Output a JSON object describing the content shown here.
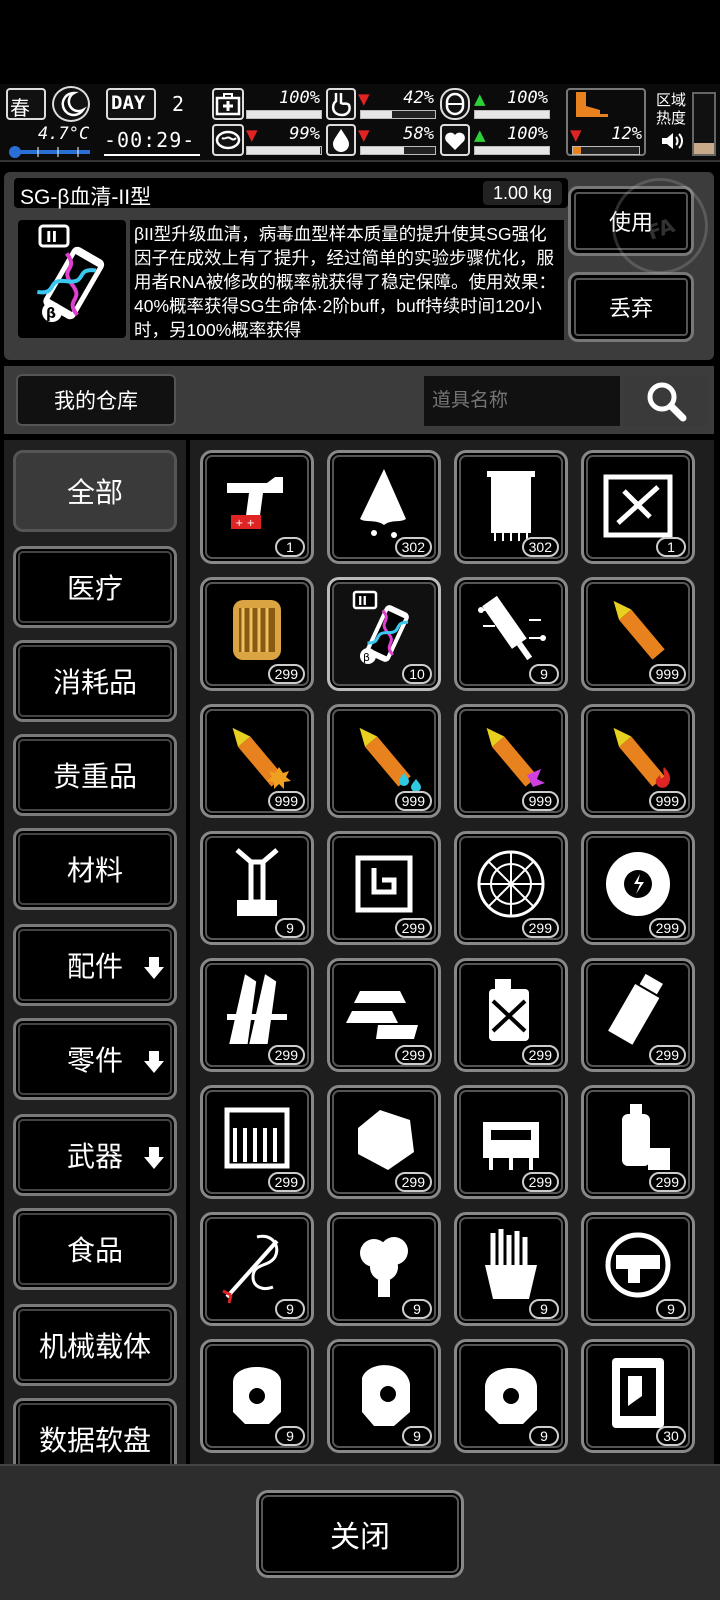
{
  "status": {
    "season": "春",
    "day_label": "DAY",
    "day": "2",
    "temperature": "4.7°C",
    "clock": "-00:29-",
    "stats": [
      {
        "name": "health",
        "value": "100%",
        "trend": "none",
        "level": 1.0
      },
      {
        "name": "hunger",
        "value": "42%",
        "trend": "down",
        "level": 0.42
      },
      {
        "name": "sanity",
        "value": "100%",
        "trend": "up",
        "level": 1.0
      },
      {
        "name": "fatigue",
        "value": "99%",
        "trend": "down",
        "level": 0.99
      },
      {
        "name": "thirst",
        "value": "58%",
        "trend": "down",
        "level": 0.58
      },
      {
        "name": "mood",
        "value": "100%",
        "trend": "up",
        "level": 1.0
      }
    ],
    "boot_value": "12%",
    "boot_level": 0.12,
    "region_label_1": "区域",
    "region_label_2": "热度"
  },
  "item": {
    "name": "SG-β血清-II型",
    "weight": "1.00 kg",
    "description": "βII型升级血清，病毒血型样本质量的提升使其SG强化因子在成效上有了提升，经过简单的实验步骤优化，服用者RNA被修改的概率就获得了稳定保障。使用效果：40%概率获得SG生命体·2阶buff，buff持续时间120小时，另100%概率获得",
    "use_label": "使用",
    "discard_label": "丢弃"
  },
  "warehouse": {
    "title": "我的仓库",
    "search_placeholder": "道具名称"
  },
  "categories": [
    {
      "label": "全部",
      "active": true,
      "expand": false
    },
    {
      "label": "医疗",
      "active": false,
      "expand": false
    },
    {
      "label": "消耗品",
      "active": false,
      "expand": false
    },
    {
      "label": "贵重品",
      "active": false,
      "expand": false
    },
    {
      "label": "材料",
      "active": false,
      "expand": false
    },
    {
      "label": "配件",
      "active": false,
      "expand": true
    },
    {
      "label": "零件",
      "active": false,
      "expand": true
    },
    {
      "label": "武器",
      "active": false,
      "expand": true
    },
    {
      "label": "食品",
      "active": false,
      "expand": false
    },
    {
      "label": "机械载体",
      "active": false,
      "expand": false
    },
    {
      "label": "数据软盘",
      "active": false,
      "expand": false
    }
  ],
  "items": [
    {
      "icon": "flare-gun-icon",
      "qty": "1"
    },
    {
      "icon": "cloth-scrap-icon",
      "qty": "302"
    },
    {
      "icon": "towel-icon",
      "qty": "302"
    },
    {
      "icon": "weapon-crate-icon",
      "qty": "1"
    },
    {
      "icon": "gold-capsule-icon",
      "qty": "299"
    },
    {
      "icon": "serum-vial-icon",
      "qty": "10",
      "selected": true
    },
    {
      "icon": "syringe-circuit-icon",
      "qty": "9"
    },
    {
      "icon": "bullet-icon",
      "qty": "999"
    },
    {
      "icon": "bullet-explosive-icon",
      "qty": "999"
    },
    {
      "icon": "bullet-water-icon",
      "qty": "999"
    },
    {
      "icon": "bullet-toxic-icon",
      "qty": "999"
    },
    {
      "icon": "bullet-fire-icon",
      "qty": "999"
    },
    {
      "icon": "mechanical-arm-icon",
      "qty": "9"
    },
    {
      "icon": "armor-plate-icon",
      "qty": "299"
    },
    {
      "icon": "web-net-icon",
      "qty": "299"
    },
    {
      "icon": "power-core-icon",
      "qty": "299"
    },
    {
      "icon": "wooden-stakes-icon",
      "qty": "299"
    },
    {
      "icon": "ingots-icon",
      "qty": "299"
    },
    {
      "icon": "fuel-canister-icon",
      "qty": "299"
    },
    {
      "icon": "bottle-icon",
      "qty": "299"
    },
    {
      "icon": "supply-box-icon",
      "qty": "299"
    },
    {
      "icon": "crystal-ore-icon",
      "qty": "299"
    },
    {
      "icon": "circuit-board-icon",
      "qty": "299"
    },
    {
      "icon": "spray-can-icon",
      "qty": "299"
    },
    {
      "icon": "dragon-staff-icon",
      "qty": "9"
    },
    {
      "icon": "broccoli-icon",
      "qty": "9"
    },
    {
      "icon": "fries-icon",
      "qty": "9"
    },
    {
      "icon": "gun-emblem-icon",
      "qty": "9"
    },
    {
      "icon": "mech-helmet-icon",
      "qty": "9"
    },
    {
      "icon": "mech-helmet-2-icon",
      "qty": "9"
    },
    {
      "icon": "mech-helmet-3-icon",
      "qty": "9"
    },
    {
      "icon": "data-card-icon",
      "qty": "30"
    }
  ],
  "footer": {
    "close_label": "关闭"
  },
  "colors": {
    "accent_orange": "#e8821e",
    "up_green": "#2fcf3a",
    "down_red": "#e02424"
  }
}
